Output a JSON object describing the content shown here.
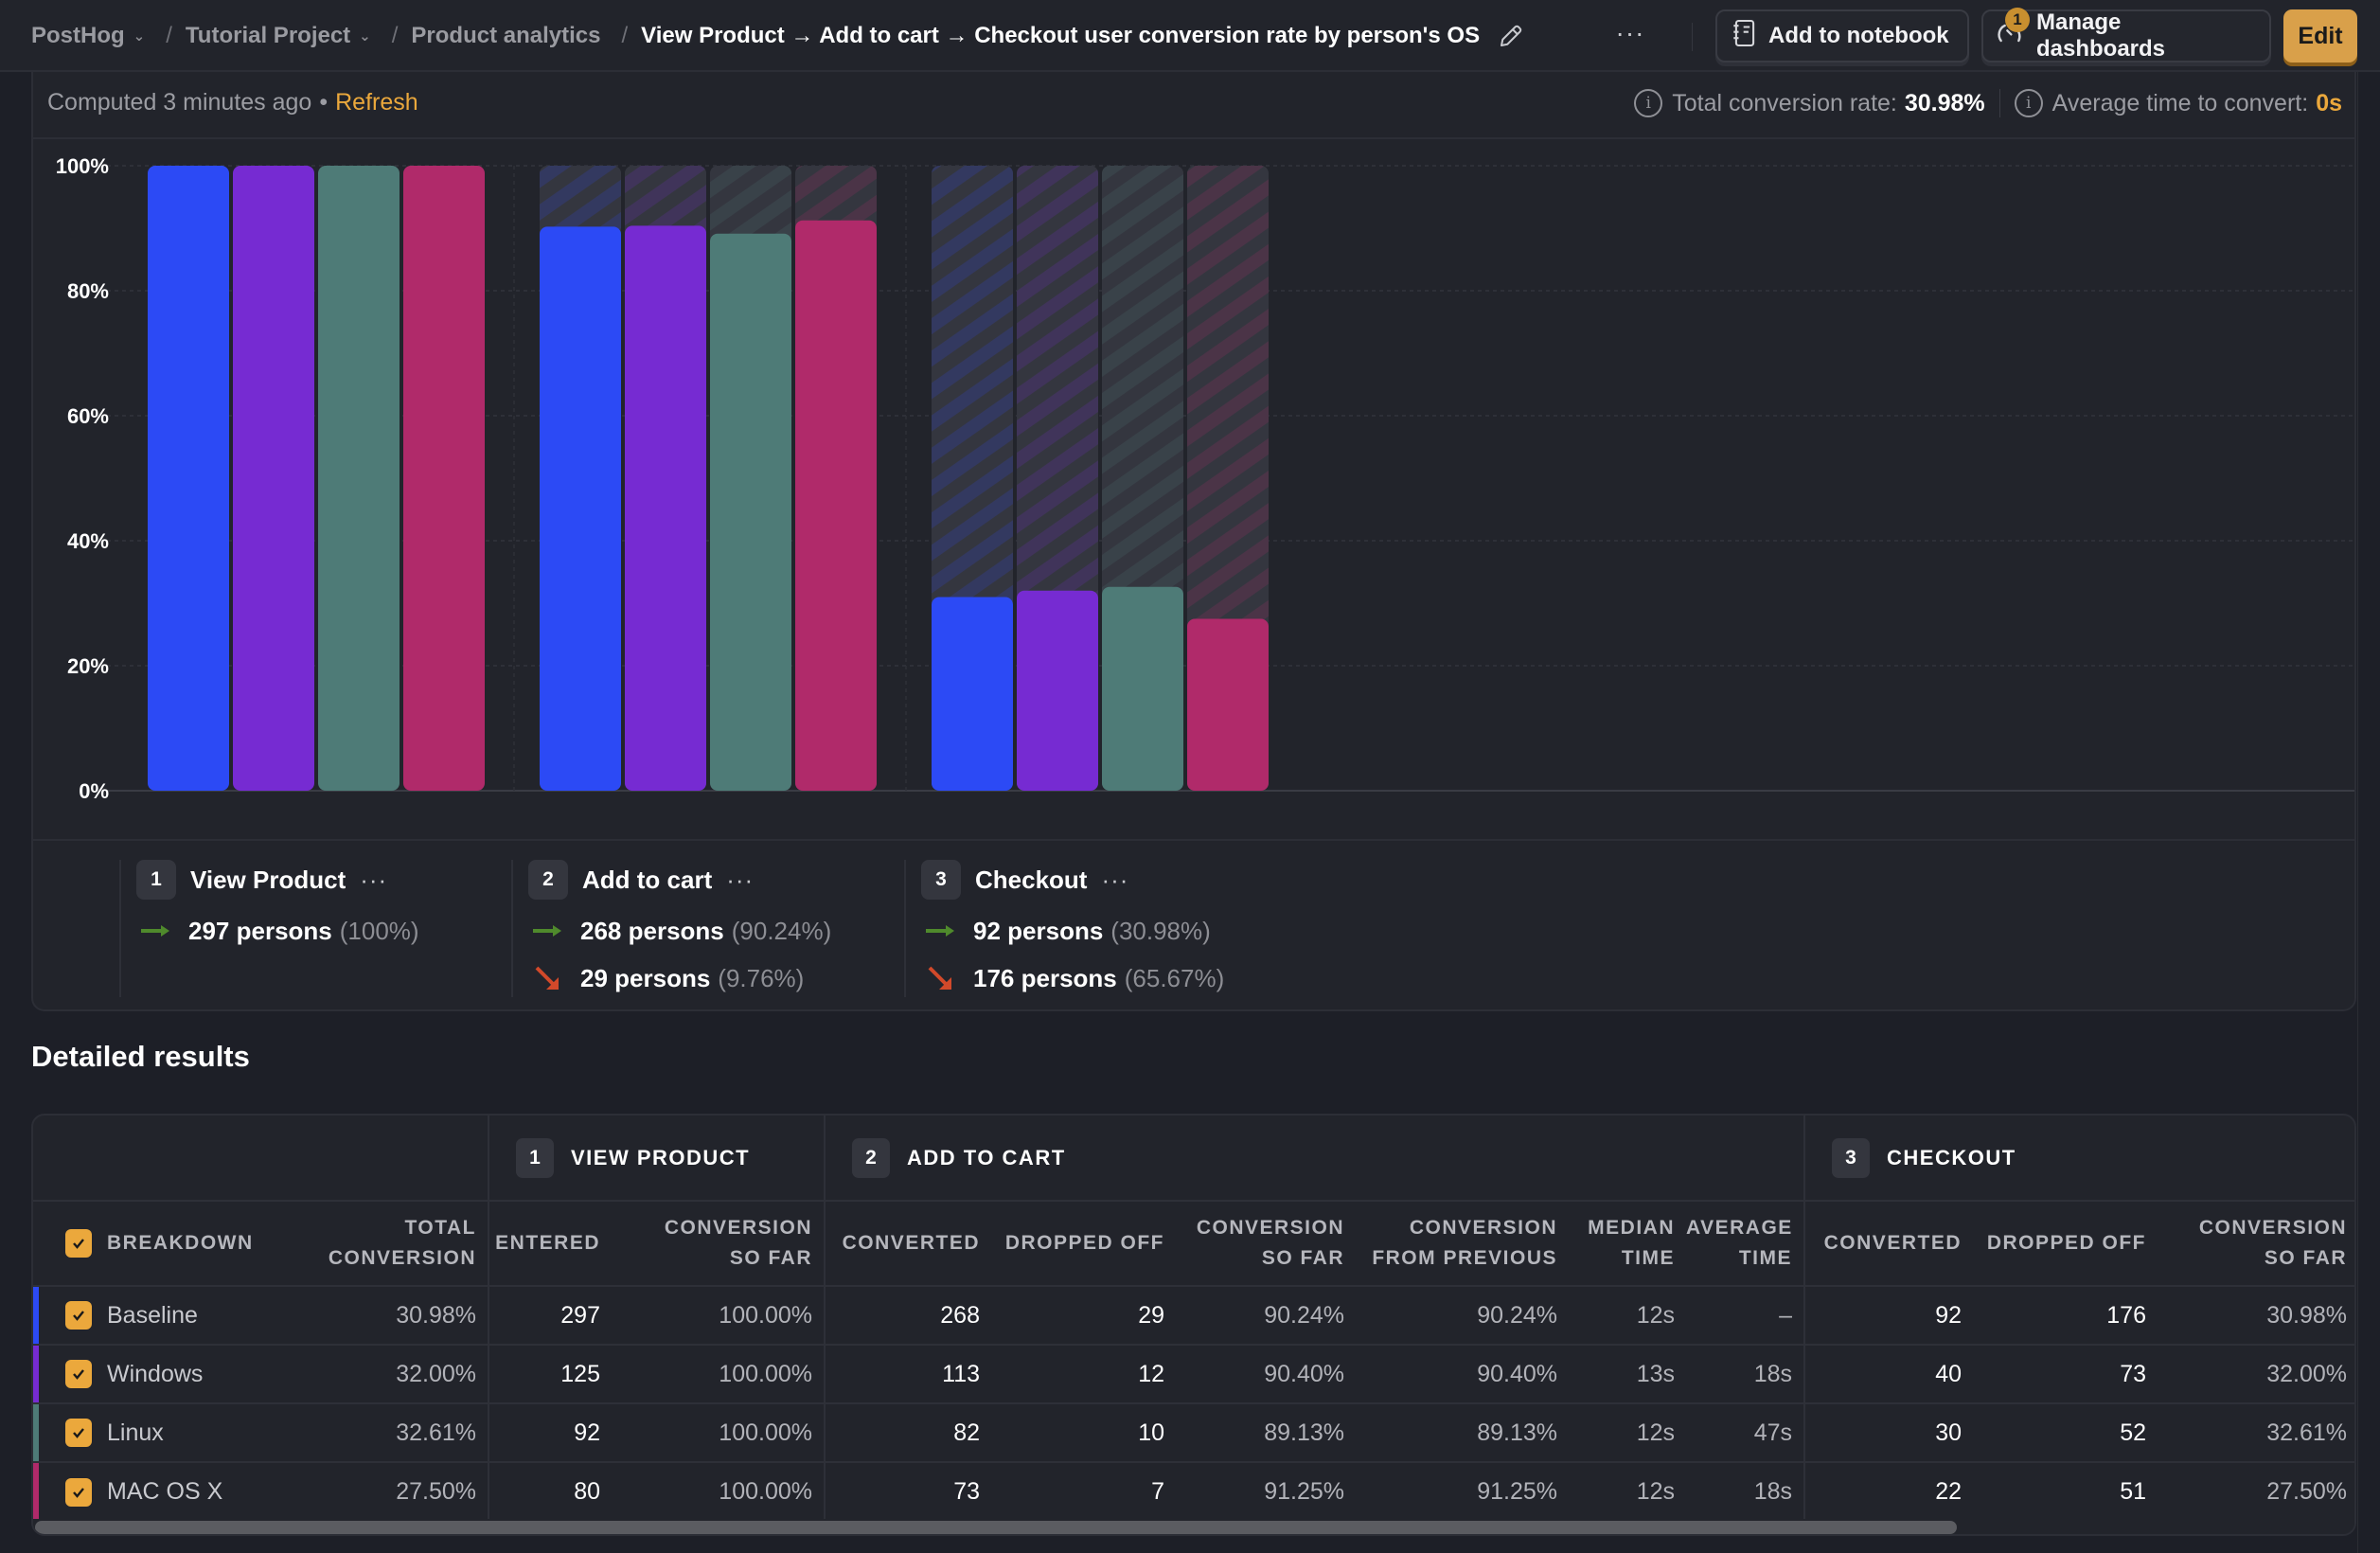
{
  "header": {
    "breadcrumbs": [
      {
        "label": "PostHog",
        "dropdown": true
      },
      {
        "label": "Tutorial Project",
        "dropdown": true
      },
      {
        "label": "Product analytics",
        "dropdown": false
      }
    ],
    "title": "View Product → Add to cart → Checkout user conversion rate by person's OS",
    "more_label": "···",
    "add_to_notebook_label": "Add to notebook",
    "manage_dashboards_label": "Manage dashboards",
    "dashboards_badge": "1",
    "edit_label": "Edit"
  },
  "summary": {
    "computed_text": "Computed 3 minutes ago",
    "dot": "•",
    "refresh_label": "Refresh",
    "total_conversion_label": "Total conversion rate:",
    "total_conversion_value": "30.98%",
    "avg_time_label": "Average time to convert:",
    "avg_time_value": "0s",
    "info_icon": "i"
  },
  "chart_data": {
    "type": "bar",
    "title": "",
    "xlabel": "",
    "ylabel": "",
    "ylim": [
      0,
      100
    ],
    "y_ticks": [
      "0%",
      "20%",
      "40%",
      "60%",
      "80%",
      "100%"
    ],
    "grid": true,
    "categories": [
      "View Product",
      "Add to cart",
      "Checkout"
    ],
    "series": [
      {
        "name": "Baseline",
        "color": "#2c4af5",
        "values": [
          100,
          90.24,
          30.98
        ]
      },
      {
        "name": "Windows",
        "color": "#762bd2",
        "values": [
          100,
          90.4,
          32.0
        ]
      },
      {
        "name": "Linux",
        "color": "#4e7b77",
        "values": [
          100,
          89.13,
          32.61
        ]
      },
      {
        "name": "MAC OS X",
        "color": "#b02a6a",
        "values": [
          100,
          91.25,
          27.5
        ]
      }
    ],
    "dropoff_style": "hatched"
  },
  "steps": [
    {
      "num": "1",
      "name": "View Product",
      "more": "···",
      "converted": "297 persons",
      "converted_pct": "(100%)",
      "dropped": null,
      "dropped_pct": null
    },
    {
      "num": "2",
      "name": "Add to cart",
      "more": "···",
      "converted": "268 persons",
      "converted_pct": "(90.24%)",
      "dropped": "29 persons",
      "dropped_pct": "(9.76%)"
    },
    {
      "num": "3",
      "name": "Checkout",
      "more": "···",
      "converted": "92 persons",
      "converted_pct": "(30.98%)",
      "dropped": "176 persons",
      "dropped_pct": "(65.67%)"
    }
  ],
  "colors": {
    "accent": "#eba83c",
    "converted_arrow": "#4f8a2c",
    "dropped_arrow": "#d2492a"
  },
  "results": {
    "title": "Detailed results",
    "groups": [
      {
        "num": "1",
        "label": "VIEW PRODUCT"
      },
      {
        "num": "2",
        "label": "ADD TO CART"
      },
      {
        "num": "3",
        "label": "CHECKOUT"
      }
    ],
    "columns": {
      "breakdown": "BREAKDOWN",
      "total_conversion": [
        "TOTAL",
        "CONVERSION"
      ],
      "entered": "ENTERED",
      "conv_so_far_1": [
        "CONVERSION",
        "SO FAR"
      ],
      "converted_2": "CONVERTED",
      "dropped_2": "DROPPED OFF",
      "conv_so_far_2": [
        "CONVERSION",
        "SO FAR"
      ],
      "conv_from_prev_2": [
        "CONVERSION",
        "FROM PREVIOUS"
      ],
      "median_time_2": [
        "MEDIAN",
        "TIME"
      ],
      "avg_time_2": [
        "AVERAGE",
        "TIME"
      ],
      "converted_3": "CONVERTED",
      "dropped_3": "DROPPED OFF",
      "conv_so_far_3": [
        "CONVERSION",
        "SO FAR"
      ]
    },
    "rows": [
      {
        "breakdown": "Baseline",
        "color": "#2c4af5",
        "checked": true,
        "total_conversion": "30.98%",
        "entered": "297",
        "conv_so_far_1": "100.00%",
        "converted_2": "268",
        "dropped_2": "29",
        "conv_so_far_2": "90.24%",
        "conv_from_prev_2": "90.24%",
        "median_time_2": "12s",
        "avg_time_2": "–",
        "converted_3": "92",
        "dropped_3": "176",
        "conv_so_far_3": "30.98%"
      },
      {
        "breakdown": "Windows",
        "color": "#762bd2",
        "checked": true,
        "total_conversion": "32.00%",
        "entered": "125",
        "conv_so_far_1": "100.00%",
        "converted_2": "113",
        "dropped_2": "12",
        "conv_so_far_2": "90.40%",
        "conv_from_prev_2": "90.40%",
        "median_time_2": "13s",
        "avg_time_2": "18s",
        "converted_3": "40",
        "dropped_3": "73",
        "conv_so_far_3": "32.00%"
      },
      {
        "breakdown": "Linux",
        "color": "#4e7b77",
        "checked": true,
        "total_conversion": "32.61%",
        "entered": "92",
        "conv_so_far_1": "100.00%",
        "converted_2": "82",
        "dropped_2": "10",
        "conv_so_far_2": "89.13%",
        "conv_from_prev_2": "89.13%",
        "median_time_2": "12s",
        "avg_time_2": "47s",
        "converted_3": "30",
        "dropped_3": "52",
        "conv_so_far_3": "32.61%"
      },
      {
        "breakdown": "MAC OS X",
        "color": "#b02a6a",
        "checked": true,
        "total_conversion": "27.50%",
        "entered": "80",
        "conv_so_far_1": "100.00%",
        "converted_2": "73",
        "dropped_2": "7",
        "conv_so_far_2": "91.25%",
        "conv_from_prev_2": "91.25%",
        "median_time_2": "12s",
        "avg_time_2": "18s",
        "converted_3": "22",
        "dropped_3": "51",
        "conv_so_far_3": "27.50%"
      }
    ]
  }
}
